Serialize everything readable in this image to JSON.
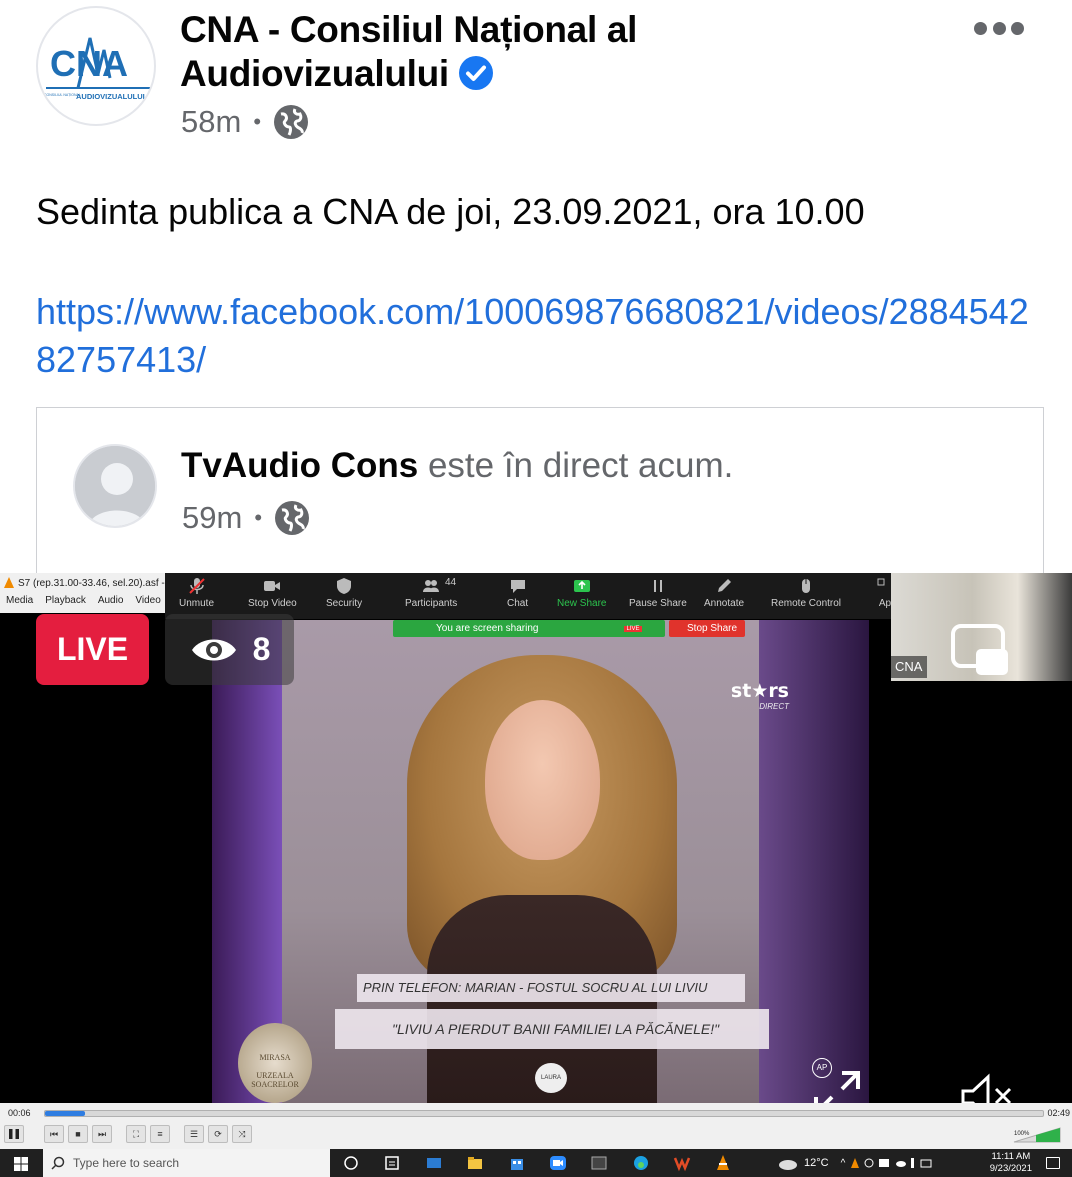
{
  "post": {
    "page_name": "CNA - Consiliul Național al Audiovizualului",
    "page_name_line1": "CNA - Consiliul Național al",
    "page_name_line2": "Audiovizualului",
    "time": "58m",
    "separator": "•",
    "avatar_logo_text": "CNA",
    "avatar_logo_subtext": "AUDIOVIZUALULUI",
    "avatar_logo_small": "CONSILIUL NAȚIONAL",
    "text": "Sedinta publica a CNA de joi, 23.09.2021, ora 10.00",
    "link": "https://www.facebook.com/100069876680821/videos/288454282757413/",
    "icons": {
      "verified": "verified-badge-icon",
      "audience": "globe-icon",
      "more": "more-options-icon"
    },
    "colors": {
      "link": "#216fdb",
      "verified": "#1877f2",
      "secondary_text": "#65676b"
    }
  },
  "shared": {
    "author": "TvAudio Cons",
    "status": "este în direct acum.",
    "time": "59m",
    "separator": "•"
  },
  "video": {
    "live_label": "LIVE",
    "viewer_count": "8",
    "vlc": {
      "title": "S7 (rep.31.00-33.46, sel.20).asf - V",
      "menu": [
        "Media",
        "Playback",
        "Audio",
        "Video"
      ],
      "time_elapsed": "00:06",
      "time_total": "02:49",
      "progress_fraction": 0.04,
      "volume_label": "100%"
    },
    "zoom": {
      "toolbar": [
        "Unmute",
        "Stop Video",
        "Security",
        "Participants",
        "Chat",
        "New Share",
        "Pause Share",
        "Annotate",
        "Remote Control",
        "Ap"
      ],
      "participants_count": "44",
      "sharing_text": "You are screen sharing",
      "live_mini": "LIVE",
      "stop_share": "Stop Share",
      "camera_label": "CNA",
      "watermark": "zoom"
    },
    "broadcast": {
      "channel_logo": "st★rs",
      "channel_sub": "DIRECT",
      "lower_third": "PRIN TELEFON: MARIAN - FOSTUL SOCRU AL LUI LIVIU",
      "quote": "\"LIVIU A PIERDUT BANII FAMILIEI LA PĂCĂNELE!\"",
      "show_logo_top": "MIRASA",
      "show_logo": "URZEALA SOACRELOR",
      "name_tag": "LAURA",
      "ap_badge": "AP"
    }
  },
  "taskbar": {
    "search_placeholder": "Type here to search",
    "temperature": "12°C",
    "time": "11:11 AM",
    "date": "9/23/2021"
  }
}
